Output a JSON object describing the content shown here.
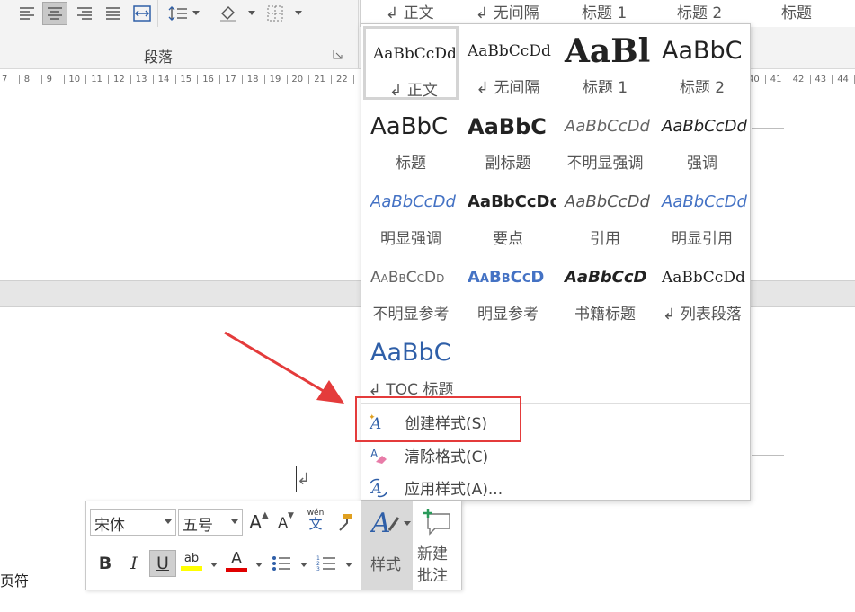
{
  "ribbon": {
    "group_label": "段落",
    "strip_styles": [
      "↲ 正文",
      "↲ 无间隔",
      "标题 1",
      "标题 2",
      "标题"
    ]
  },
  "ruler": {
    "ticks": [
      "7",
      "8",
      "9",
      "10",
      "11",
      "12",
      "13",
      "14",
      "15",
      "16",
      "17",
      "18",
      "19",
      "20",
      "21",
      "22"
    ],
    "ticks_right": [
      "40",
      "41",
      "42",
      "43",
      "44"
    ]
  },
  "gallery": {
    "styles": [
      {
        "preview": "AaBbCcDd",
        "name": "↲ 正文",
        "selected": true
      },
      {
        "preview": "AaBbCcDd",
        "name": "↲ 无间隔",
        "selected": false
      },
      {
        "preview": "AaBl",
        "name": "标题 1",
        "selected": false
      },
      {
        "preview": "AaBbC",
        "name": "标题 2",
        "selected": false
      },
      {
        "preview": "AaBbC",
        "name": "标题",
        "selected": false
      },
      {
        "preview": "AaBbC",
        "name": "副标题",
        "selected": false
      },
      {
        "preview": "AaBbCcDd",
        "name": "不明显强调",
        "selected": false
      },
      {
        "preview": "AaBbCcDd",
        "name": "强调",
        "selected": false
      },
      {
        "preview": "AaBbCcDd",
        "name": "明显强调",
        "selected": false
      },
      {
        "preview": "AaBbCcDd",
        "name": "要点",
        "selected": false
      },
      {
        "preview": "AaBbCcDd",
        "name": "引用",
        "selected": false
      },
      {
        "preview": "AaBbCcDd",
        "name": "明显引用",
        "selected": false
      },
      {
        "preview": "AaBbCcDd",
        "name": "不明显参考",
        "selected": false
      },
      {
        "preview": "AaBbCcD",
        "name": "明显参考",
        "selected": false
      },
      {
        "preview": "AaBbCcD",
        "name": "书籍标题",
        "selected": false
      },
      {
        "preview": "AaBbCcDd",
        "name": "↲ 列表段落",
        "selected": false
      },
      {
        "preview": "AaBbC",
        "name": "↲ TOC 标题",
        "selected": false
      }
    ],
    "menu": {
      "create_style": "创建样式(S)",
      "clear_format": "清除格式(C)",
      "apply_style": "应用样式(A)..."
    }
  },
  "document": {
    "paragraph_mark": "↲",
    "footer_text": "页符"
  },
  "mini_toolbar": {
    "font_name": "宋体",
    "font_size": "五号",
    "grow_font": "A",
    "shrink_font": "A",
    "phonetic_top": "wén",
    "phonetic_bottom": "文",
    "bold": "B",
    "italic": "I",
    "underline": "U",
    "highlight": "ab",
    "font_color": "A",
    "styles_label": "样式",
    "new_comment_line1": "新建",
    "new_comment_line2": "批注"
  },
  "colors": {
    "annotation_red": "#e43b3b",
    "highlight_yellow": "#ffff00",
    "font_color_red": "#e00000",
    "accent_blue": "#2f5fa8"
  }
}
